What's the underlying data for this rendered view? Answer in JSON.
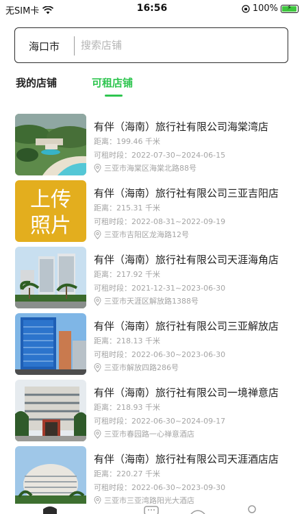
{
  "status_bar": {
    "carrier": "无SIM卡",
    "time": "16:56",
    "battery": "100%",
    "battery_level": 1.0
  },
  "search": {
    "city": "海口市",
    "placeholder": "搜索店铺"
  },
  "tabs": [
    {
      "label": "我的店铺",
      "active": false
    },
    {
      "label": "可租店铺",
      "active": true
    }
  ],
  "accent_color": "#2ec54f",
  "shops": [
    {
      "name": "有伴（海南）旅行社有限公司海棠湾店",
      "distance": "距离：199.46 千米",
      "period": "可租时段：2022-07-30~2024-06-15",
      "address": "三亚市海棠区海棠北路88号",
      "image": "resort-beach"
    },
    {
      "name": "有伴（海南）旅行社有限公司三亚吉阳店",
      "distance": "距离：215.31 千米",
      "period": "可租时段：2022-08-31~2022-09-19",
      "address": "三亚市吉阳区龙海路12号",
      "image": "upload-photo",
      "image_text_1": "上传",
      "image_text_2": "照片"
    },
    {
      "name": "有伴（海南）旅行社有限公司天涯海角店",
      "distance": "距离：217.92 千米",
      "period": "可租时段：2021-12-31~2023-06-30",
      "address": "三亚市天涯区解放路1388号",
      "image": "towers-palms"
    },
    {
      "name": "有伴（海南）旅行社有限公司三亚解放店",
      "distance": "距离：218.13 千米",
      "period": "可租时段：2022-06-30~2023-06-30",
      "address": "三亚市解放四路286号",
      "image": "blue-glass-tower"
    },
    {
      "name": "有伴（海南）旅行社有限公司一境禅意店",
      "distance": "距离：218.93 千米",
      "period": "可租时段：2022-06-30~2024-09-17",
      "address": "三亚市春园路一心禅意酒店",
      "image": "hotel-building"
    },
    {
      "name": "有伴（海南）旅行社有限公司天涯酒店店",
      "distance": "距离：220.27 千米",
      "period": "可租时段：2022-06-30~2023-09-30",
      "address": "三亚市三亚湾路阳光大酒店",
      "image": "round-hotel"
    }
  ]
}
